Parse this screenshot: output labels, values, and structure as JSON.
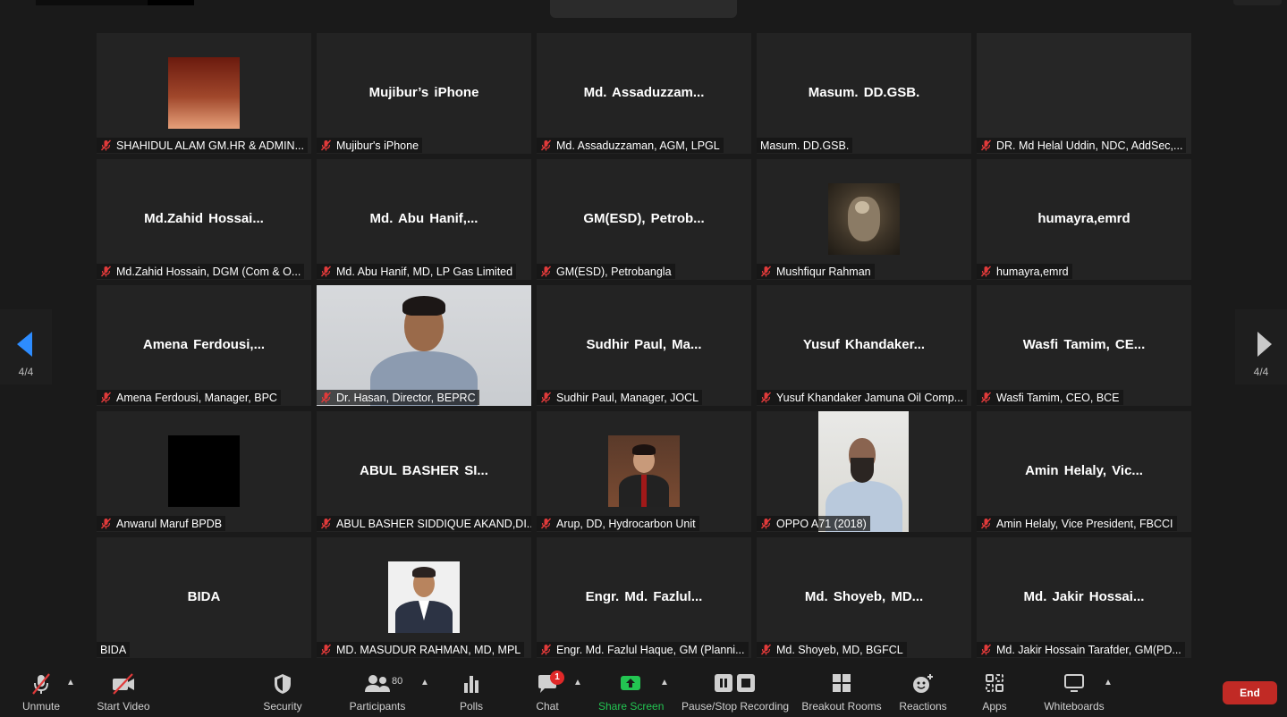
{
  "colors": {
    "background": "#1a1a1a",
    "tile": "#232323",
    "share_green": "#23c552",
    "end_red": "#c12a25",
    "muted_red": "#e03a3a",
    "nav_blue": "#2d8cff"
  },
  "participants": [
    {
      "name": "",
      "label": "SHAHIDUL ALAM GM.HR & ADMIN...",
      "muted": true,
      "avatar": "gradient"
    },
    {
      "name": "Mujibur’s iPhone",
      "label": "Mujibur's iPhone",
      "muted": true
    },
    {
      "name": "Md.  Assaduzzam...",
      "label": "Md. Assaduzzaman, AGM, LPGL",
      "muted": true
    },
    {
      "name": "Masum.  DD.GSB.",
      "label": "Masum. DD.GSB.",
      "muted": false
    },
    {
      "name": "",
      "label": "DR. Md Helal Uddin, NDC, AddSec,...",
      "muted": true,
      "avatar": "blank"
    },
    {
      "name": "Md.Zahid  Hossai...",
      "label": "Md.Zahid Hossain, DGM (Com & O...",
      "muted": true
    },
    {
      "name": "Md.  Abu  Hanif,...",
      "label": "Md. Abu Hanif, MD, LP Gas Limited",
      "muted": true
    },
    {
      "name": "GM(ESD),  Petrob...",
      "label": "GM(ESD), Petrobangla",
      "muted": true
    },
    {
      "name": "",
      "label": "Mushfiqur Rahman",
      "muted": true,
      "avatar": "bird"
    },
    {
      "name": "humayra,emrd",
      "label": "humayra,emrd",
      "muted": true
    },
    {
      "name": "Amena  Ferdousi,...",
      "label": "Amena Ferdousi, Manager, BPC",
      "muted": true
    },
    {
      "name": "",
      "label": "Dr. Hasan, Director, BEPRC",
      "muted": true,
      "avatar": "video"
    },
    {
      "name": "Sudhir  Paul,  Ma...",
      "label": "Sudhir Paul, Manager, JOCL",
      "muted": true
    },
    {
      "name": "Yusuf  Khandaker...",
      "label": "Yusuf Khandaker Jamuna Oil Comp...",
      "muted": true
    },
    {
      "name": "Wasfi  Tamim,  CE...",
      "label": "Wasfi Tamim, CEO, BCE",
      "muted": true
    },
    {
      "name": "",
      "label": "Anwarul Maruf BPDB",
      "muted": true,
      "avatar": "black"
    },
    {
      "name": "ABUL  BASHER  SI...",
      "label": "ABUL BASHER SIDDIQUE AKAND,DI...",
      "muted": true
    },
    {
      "name": "",
      "label": "Arup, DD, Hydrocarbon Unit",
      "muted": true,
      "avatar": "person"
    },
    {
      "name": "",
      "label": "OPPO A71 (2018)",
      "muted": true,
      "avatar": "video2"
    },
    {
      "name": "Amin  Helaly,  Vic...",
      "label": "Amin Helaly, Vice President, FBCCI",
      "muted": true
    },
    {
      "name": "BIDA",
      "label": "BIDA",
      "muted": false
    },
    {
      "name": "",
      "label": "MD. MASUDUR RAHMAN, MD, MPL",
      "muted": true,
      "avatar": "formal"
    },
    {
      "name": "Engr.  Md.  Fazlul...",
      "label": "Engr. Md. Fazlul Haque, GM (Planni...",
      "muted": true
    },
    {
      "name": "Md.  Shoyeb,  MD...",
      "label": "Md. Shoyeb, MD, BGFCL",
      "muted": true
    },
    {
      "name": "Md.  Jakir  Hossai...",
      "label": "Md. Jakir Hossain Tarafder, GM(PD...",
      "muted": true
    }
  ],
  "nav": {
    "left_page": "4/4",
    "right_page": "4/4"
  },
  "toolbar": {
    "unmute": "Unmute",
    "start_video": "Start Video",
    "security": "Security",
    "participants": "Participants",
    "participants_count": "80",
    "polls": "Polls",
    "chat": "Chat",
    "chat_badge": "1",
    "share_screen": "Share Screen",
    "pause_stop_recording": "Pause/Stop Recording",
    "breakout_rooms": "Breakout Rooms",
    "reactions": "Reactions",
    "apps": "Apps",
    "whiteboards": "Whiteboards",
    "end": "End"
  }
}
